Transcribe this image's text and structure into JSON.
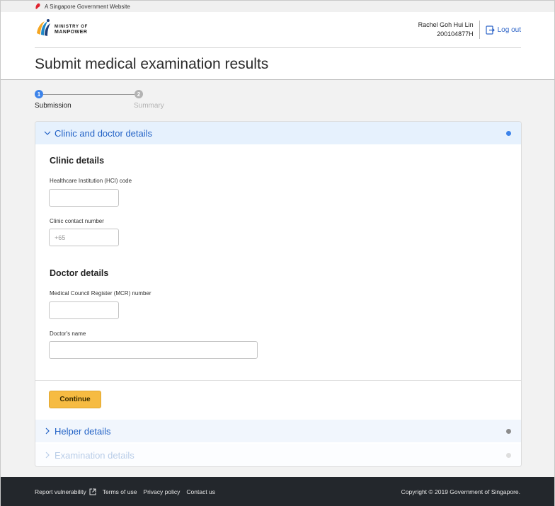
{
  "gov_banner": {
    "text": "A Singapore Government Website"
  },
  "header": {
    "logo_line1": "MINISTRY OF",
    "logo_line2": "MANPOWER",
    "user_name": "Rachel Goh Hui Lin",
    "user_id": "200104877H",
    "logout_label": "Log out"
  },
  "page": {
    "title": "Submit medical examination results"
  },
  "stepper": {
    "steps": [
      {
        "number": "1",
        "label": "Submission",
        "state": "active"
      },
      {
        "number": "2",
        "label": "Summary",
        "state": "inactive"
      }
    ]
  },
  "accordion": [
    {
      "title": "Clinic and doctor details",
      "state": "expanded",
      "dot_color": "#3c83ea"
    },
    {
      "title": "Helper details",
      "state": "collapsed",
      "dot_color": "#8c8c8c"
    },
    {
      "title": "Examination details",
      "state": "disabled",
      "dot_color": "#dedede"
    }
  ],
  "clinic": {
    "section_title": "Clinic details",
    "hci_label": "Healthcare Institution (HCI) code",
    "hci_value": "",
    "contact_label": "Clinic contact number",
    "contact_placeholder": "+65"
  },
  "doctor": {
    "section_title": "Doctor details",
    "mcr_label": "Medical Council Register (MCR) number",
    "mcr_value": "",
    "name_label": "Doctor's name",
    "name_value": ""
  },
  "continue_label": "Continue",
  "footer": {
    "links": [
      "Report vulnerability",
      "Terms of use",
      "Privacy policy",
      "Contact us"
    ],
    "copyright": "Copyright © 2019 Government of Singapore."
  },
  "colors": {
    "accent_blue": "#2262c6",
    "step_active": "#3c83ea",
    "step_inactive": "#b3b3b3",
    "continue_button": "#f6bb42",
    "footer_bg": "#23272c"
  }
}
